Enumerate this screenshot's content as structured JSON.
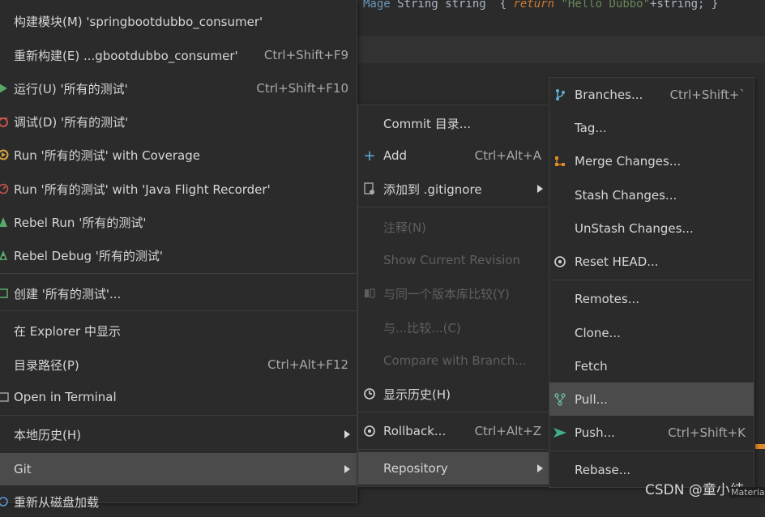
{
  "editor": {
    "code": {
      "prefix": "Mage",
      "t1": " String ",
      "t2": "string",
      "t3": "  { ",
      "kw": "return",
      "t4": " ",
      "str": "\"Hello Dubbo\"",
      "t5": "+string; }"
    }
  },
  "watermark": "CSDN @童小纯",
  "watermark2": "Materia",
  "menu1": {
    "items": [
      {
        "label": "构建模块(M) 'springbootdubbo_consumer'",
        "shortcut": ""
      },
      {
        "label": "重新构建(E) ...gbootdubbo_consumer'",
        "shortcut": "Ctrl+Shift+F9"
      },
      {
        "label": "运行(U) '所有的测试'",
        "shortcut": "Ctrl+Shift+F10"
      },
      {
        "label": "调试(D) '所有的测试'",
        "shortcut": ""
      },
      {
        "label": "Run '所有的测试' with Coverage",
        "shortcut": ""
      },
      {
        "label": "Run '所有的测试' with 'Java Flight Recorder'",
        "shortcut": ""
      },
      {
        "label": "Rebel Run '所有的测试'",
        "shortcut": ""
      },
      {
        "label": "Rebel Debug '所有的测试'",
        "shortcut": ""
      },
      {
        "label": "创建 '所有的测试'...",
        "shortcut": ""
      },
      {
        "label": "在 Explorer 中显示",
        "shortcut": ""
      },
      {
        "label": "目录路径(P)",
        "shortcut": "Ctrl+Alt+F12"
      },
      {
        "label": "Open in Terminal",
        "shortcut": ""
      },
      {
        "label": "本地历史(H)",
        "shortcut": ""
      },
      {
        "label": "Git",
        "shortcut": ""
      },
      {
        "label": "重新从磁盘加载",
        "shortcut": ""
      }
    ]
  },
  "menu2": {
    "items": [
      {
        "label": "Commit 目录...",
        "shortcut": ""
      },
      {
        "label": "Add",
        "shortcut": "Ctrl+Alt+A"
      },
      {
        "label": "添加到 .gitignore",
        "shortcut": ""
      },
      {
        "label": "注释(N)",
        "shortcut": ""
      },
      {
        "label": "Show Current Revision",
        "shortcut": ""
      },
      {
        "label": "与同一个版本库比较(Y)",
        "shortcut": ""
      },
      {
        "label": "与...比较...(C)",
        "shortcut": ""
      },
      {
        "label": "Compare with Branch...",
        "shortcut": ""
      },
      {
        "label": "显示历史(H)",
        "shortcut": ""
      },
      {
        "label": "Rollback...",
        "shortcut": "Ctrl+Alt+Z"
      },
      {
        "label": "Repository",
        "shortcut": ""
      }
    ]
  },
  "menu3": {
    "items": [
      {
        "label": "Branches...",
        "shortcut": "Ctrl+Shift+`"
      },
      {
        "label": "Tag...",
        "shortcut": ""
      },
      {
        "label": "Merge Changes...",
        "shortcut": ""
      },
      {
        "label": "Stash Changes...",
        "shortcut": ""
      },
      {
        "label": "UnStash Changes...",
        "shortcut": ""
      },
      {
        "label": "Reset HEAD...",
        "shortcut": ""
      },
      {
        "label": "Remotes...",
        "shortcut": ""
      },
      {
        "label": "Clone...",
        "shortcut": ""
      },
      {
        "label": "Fetch",
        "shortcut": ""
      },
      {
        "label": "Pull...",
        "shortcut": ""
      },
      {
        "label": "Push...",
        "shortcut": "Ctrl+Shift+K"
      },
      {
        "label": "Rebase...",
        "shortcut": ""
      }
    ]
  },
  "colors": {
    "background": "#2b2b2b",
    "selected": "#4b4b4b",
    "disabled_text": "#5f5f5f",
    "accent": "#e08a28"
  }
}
